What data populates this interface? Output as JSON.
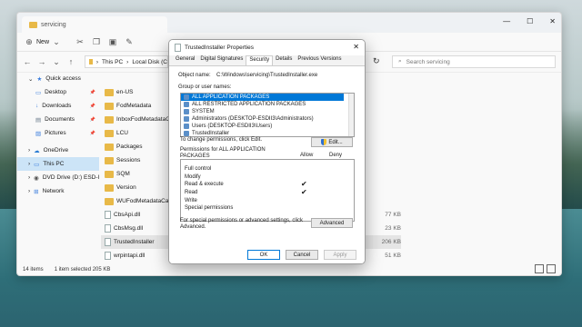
{
  "explorer": {
    "tab_title": "servicing",
    "toolbar": {
      "new_label": "New"
    },
    "breadcrumb": [
      "This PC",
      "Local Disk (C"
    ],
    "search_placeholder": "Search servicing",
    "nav": [
      {
        "label": "Quick access",
        "icon": "star-icon",
        "pinned": false
      },
      {
        "label": "Desktop",
        "icon": "desktop-icon",
        "pinned": true
      },
      {
        "label": "Downloads",
        "icon": "download-icon",
        "pinned": true
      },
      {
        "label": "Documents",
        "icon": "document-icon",
        "pinned": true
      },
      {
        "label": "Pictures",
        "icon": "picture-icon",
        "pinned": true
      },
      {
        "label": "OneDrive",
        "icon": "cloud-icon",
        "pinned": false
      },
      {
        "label": "This PC",
        "icon": "computer-icon",
        "pinned": false
      },
      {
        "label": "DVD Drive (D:) ESD-I",
        "icon": "dvd-icon",
        "pinned": false
      },
      {
        "label": "Network",
        "icon": "network-icon",
        "pinned": false
      }
    ],
    "files": [
      {
        "name": "en-US",
        "type": "folder",
        "size": ""
      },
      {
        "name": "FodMetadata",
        "type": "folder",
        "size": ""
      },
      {
        "name": "InboxFodMetadataCac",
        "type": "folder",
        "size": ""
      },
      {
        "name": "LCU",
        "type": "folder",
        "size": ""
      },
      {
        "name": "Packages",
        "type": "folder",
        "size": ""
      },
      {
        "name": "Sessions",
        "type": "folder",
        "size": ""
      },
      {
        "name": "SQM",
        "type": "folder",
        "size": ""
      },
      {
        "name": "Version",
        "type": "folder",
        "size": ""
      },
      {
        "name": "WUFodMetadataCach",
        "type": "folder",
        "size": ""
      },
      {
        "name": "CbsApi.dll",
        "type": "file",
        "size": "77 KB"
      },
      {
        "name": "CbsMsg.dll",
        "type": "file",
        "size": "23 KB"
      },
      {
        "name": "TrustedInstaller",
        "type": "file",
        "size": "206 KB"
      },
      {
        "name": "wrpintapi.dll",
        "type": "file",
        "size": "51 KB"
      }
    ],
    "status": {
      "count": "14 items",
      "selected": "1 item selected  205 KB"
    }
  },
  "dialog": {
    "title": "TrustedInstaller Properties",
    "tabs": [
      "General",
      "Digital Signatures",
      "Security",
      "Details",
      "Previous Versions"
    ],
    "active_tab": "Security",
    "object_label": "Object name:",
    "object_value": "C:\\Windows\\servicing\\TrustedInstaller.exe",
    "group_label": "Group or user names:",
    "users": [
      "ALL APPLICATION PACKAGES",
      "ALL RESTRICTED APPLICATION PACKAGES",
      "SYSTEM",
      "Administrators (DESKTOP-ESDII3\\Administrators)",
      "Users (DESKTOP-ESDII3\\Users)",
      "TrustedInstaller"
    ],
    "change_text": "To change permissions, click Edit.",
    "edit_label": "Edit...",
    "perm_title": "Permissions for ALL APPLICATION PACKAGES",
    "allow_label": "Allow",
    "deny_label": "Deny",
    "permissions": [
      {
        "name": "Full control",
        "allow": ""
      },
      {
        "name": "Modify",
        "allow": ""
      },
      {
        "name": "Read & execute",
        "allow": "✔"
      },
      {
        "name": "Read",
        "allow": "✔"
      },
      {
        "name": "Write",
        "allow": ""
      },
      {
        "name": "Special permissions",
        "allow": ""
      }
    ],
    "advanced_text": "For special permissions or advanced settings, click Advanced.",
    "advanced_label": "Advanced",
    "ok_label": "OK",
    "cancel_label": "Cancel",
    "apply_label": "Apply"
  }
}
